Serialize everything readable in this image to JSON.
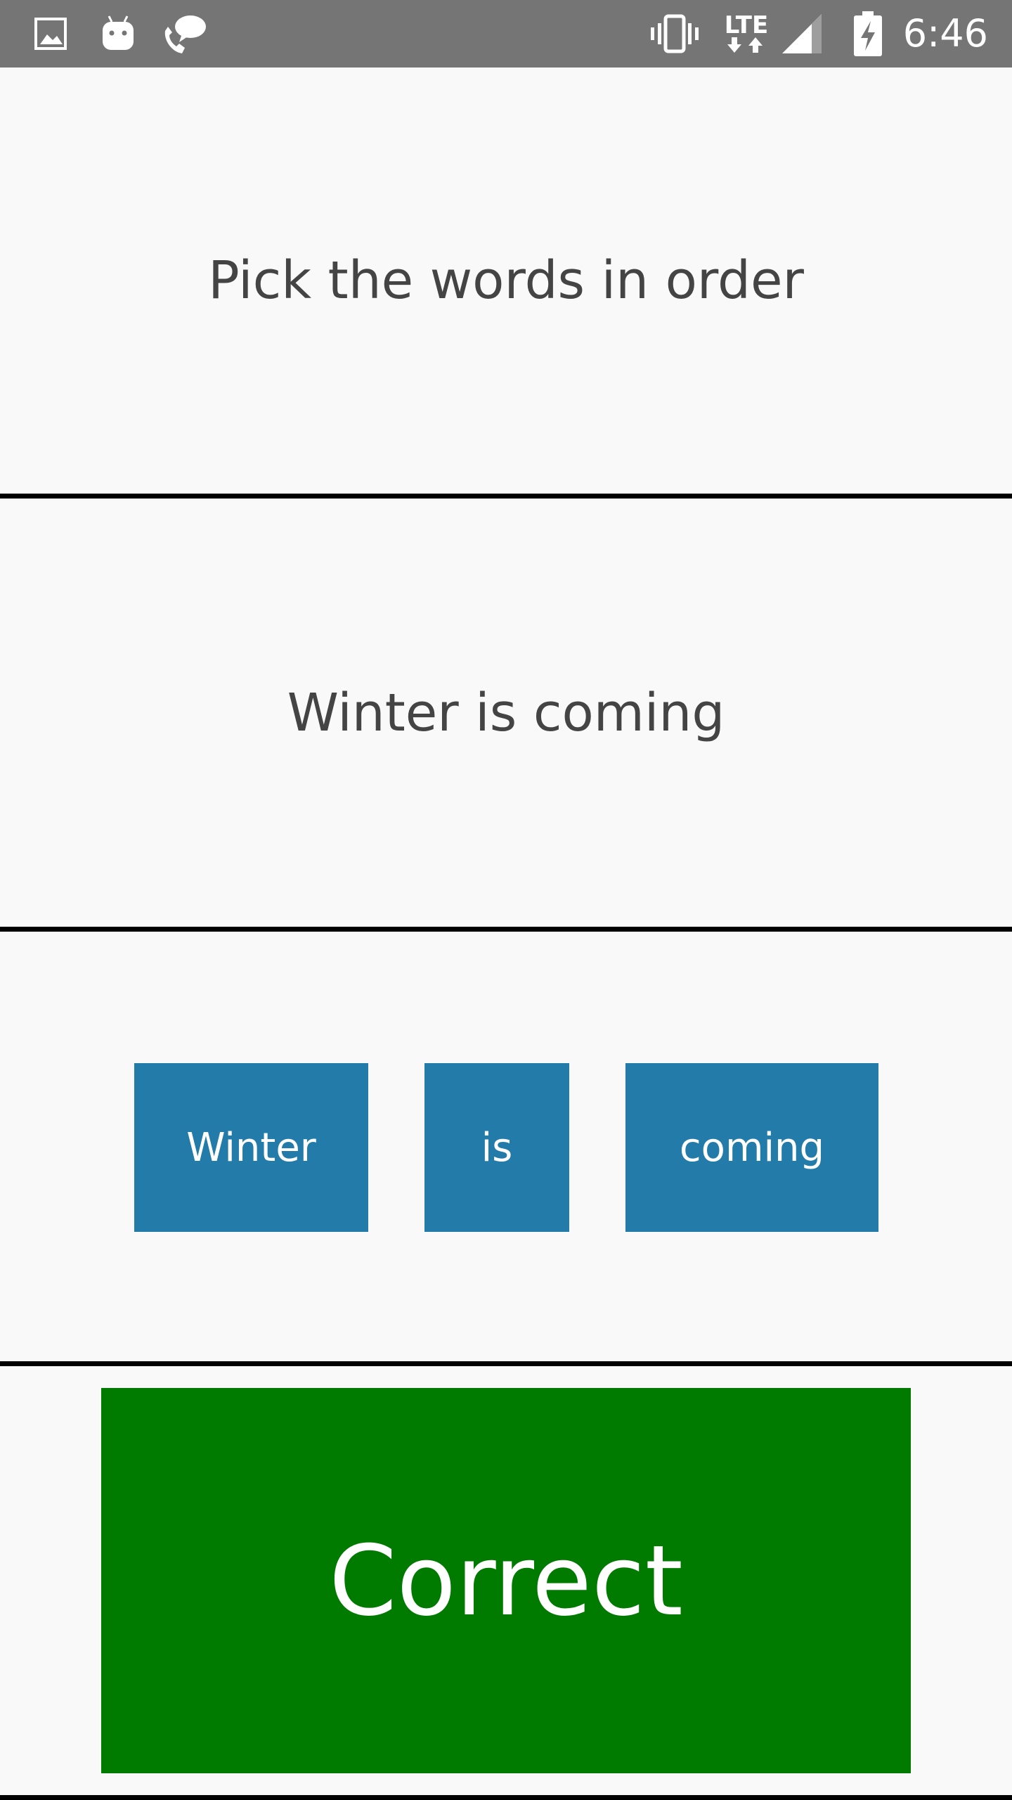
{
  "status_bar": {
    "time": "6:46",
    "left_icons": [
      "gallery-icon",
      "android-icon",
      "phone-chat-icon"
    ],
    "right_icons": [
      "vibrate-icon",
      "lte-icon",
      "signal-icon",
      "battery-charging-icon"
    ],
    "network_label": "LTE"
  },
  "prompt": {
    "text": "Pick the words in order"
  },
  "sentence": {
    "text": "Winter is coming"
  },
  "word_bank": {
    "tiles": [
      {
        "label": "Winter"
      },
      {
        "label": "is"
      },
      {
        "label": "coming"
      }
    ],
    "tile_color": "#237ba9"
  },
  "result": {
    "label": "Correct",
    "color": "#007b00"
  },
  "colors": {
    "background": "#f9f9fa",
    "status_bar": "#757575",
    "divider": "#000000",
    "text": "#444444"
  }
}
